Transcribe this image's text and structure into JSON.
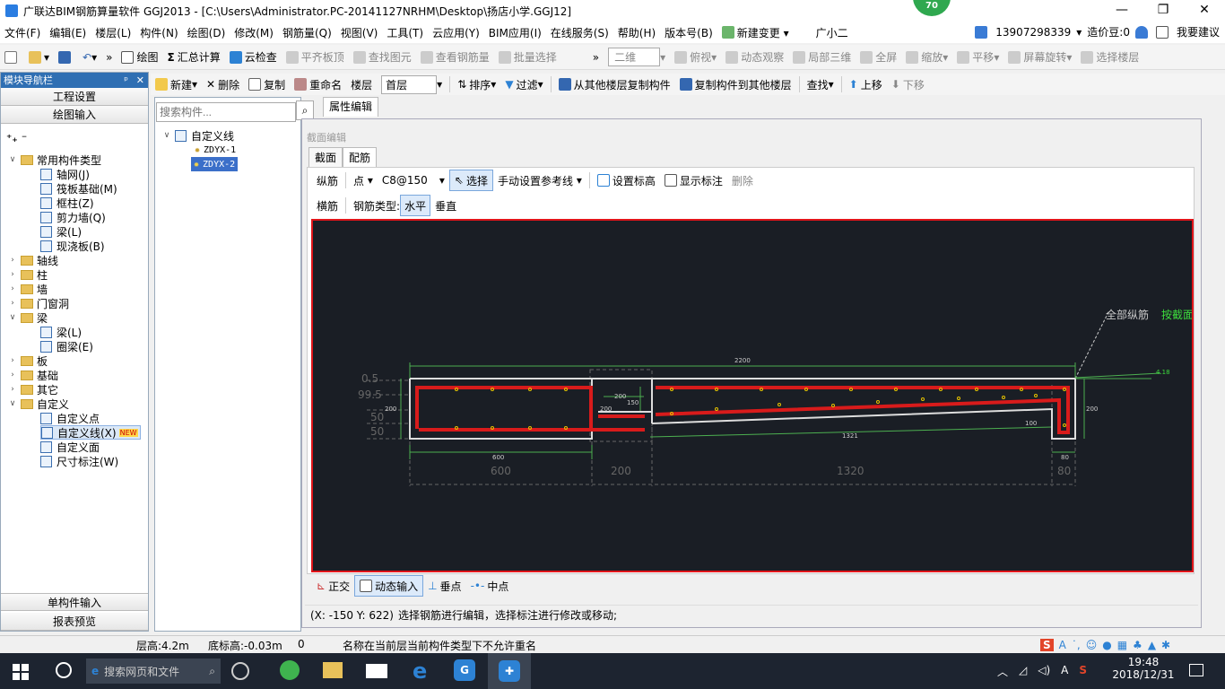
{
  "titlebar": {
    "title": "广联达BIM钢筋算量软件 GGJ2013 - [C:\\Users\\Administrator.PC-20141127NRHM\\Desktop\\扬店小学.GGJ12]",
    "badge": "70",
    "minimize": "—",
    "maximize": "❐",
    "close": "✕"
  },
  "menu": {
    "items": [
      "文件(F)",
      "编辑(E)",
      "楼层(L)",
      "构件(N)",
      "绘图(D)",
      "修改(M)",
      "钢筋量(Q)",
      "视图(V)",
      "工具(T)",
      "云应用(Y)",
      "BIM应用(I)",
      "在线服务(S)",
      "帮助(H)",
      "版本号(B)",
      "新建变更",
      "广小二"
    ],
    "phone": "13907298339",
    "price": "造价豆:0",
    "suggest": "我要建议"
  },
  "toolbar": {
    "draw": "绘图",
    "sum": "汇总计算",
    "cloud_check": "云检查",
    "align_top": "平齐板顶",
    "find": "查找图元",
    "view_rebar": "查看钢筋量",
    "batch": "批量选择",
    "view_mode": "二维",
    "top_view": "俯视",
    "dynamic": "动态观察",
    "local3d": "局部三维",
    "fullscreen": "全屏",
    "zoom": "缩放",
    "pan": "平移",
    "rotate": "屏幕旋转",
    "select_floor": "选择楼层"
  },
  "nav": {
    "header": "模块导航栏",
    "pin": "ᵖ",
    "close": "✕",
    "project_settings": "工程设置",
    "draw_input": "绘图输入",
    "items": [
      {
        "label": "常用构件类型"
      },
      {
        "label": "轴网(J)"
      },
      {
        "label": "筏板基础(M)"
      },
      {
        "label": "框柱(Z)"
      },
      {
        "label": "剪力墙(Q)"
      },
      {
        "label": "梁(L)"
      },
      {
        "label": "现浇板(B)"
      },
      {
        "label": "轴线"
      },
      {
        "label": "柱"
      },
      {
        "label": "墙"
      },
      {
        "label": "门窗洞"
      },
      {
        "label": "梁"
      },
      {
        "label": "梁(L)"
      },
      {
        "label": "圈梁(E)"
      },
      {
        "label": "板"
      },
      {
        "label": "基础"
      },
      {
        "label": "其它"
      },
      {
        "label": "自定义"
      },
      {
        "label": "自定义点"
      },
      {
        "label": "自定义线(X)"
      },
      {
        "label": "自定义面"
      },
      {
        "label": "尺寸标注(W)"
      }
    ],
    "new_tag": "NEW",
    "single_input": "单构件输入",
    "report": "报表预览"
  },
  "components": {
    "new": "新建",
    "delete": "删除",
    "copy": "复制",
    "rename": "重命名",
    "floor_label": "楼层",
    "floor_value": "首层",
    "sort": "排序",
    "filter": "过滤",
    "copy_from": "从其他楼层复制构件",
    "copy_to": "复制构件到其他楼层",
    "find": "查找",
    "up": "上移",
    "down": "下移",
    "search_placeholder": "搜索构件...",
    "root": "自定义线",
    "list": [
      "ZDYX-1",
      "ZDYX-2"
    ]
  },
  "editor": {
    "prop_tab": "属性编辑",
    "section_title": "截面编辑",
    "tabs": [
      "截面",
      "配筋"
    ],
    "longitudinal": "纵筋",
    "point": "点",
    "spacing": "C8@150",
    "select": "选择",
    "manual_ref": "手动设置参考线",
    "set_elev": "设置标高",
    "show_dim": "显示标注",
    "delete": "删除",
    "transverse": "横筋",
    "rebar_type": "钢筋类型:",
    "horizontal": "水平",
    "vertical": "垂直",
    "ortho": "正交",
    "dyn_input": "动态输入",
    "perp": "垂点",
    "mid": "中点",
    "coords": "(X: -150 Y: 622)",
    "hint": "选择钢筋进行编辑，选择标注进行修改或移动;"
  },
  "drawing": {
    "all_rebar": "全部纵筋",
    "by_section": "按截面",
    "dim_total": "2200",
    "dim_600": "600",
    "dim_200": "200",
    "dim_1320": "1320",
    "dim_80": "80",
    "dim_1321": "1321",
    "left_vals": [
      "0.5",
      "99.5",
      "50",
      "50"
    ],
    "h200": "200",
    "h200r": "200",
    "d200": "200",
    "d150": "150",
    "d100": "100",
    "lvl": "4.18"
  },
  "status": {
    "floor_height": "层高:4.2m",
    "base_elev": "底标高:-0.03m",
    "zero": "0",
    "msg": "名称在当前层当前构件类型下不允许重名"
  },
  "taskbar": {
    "search": "搜索网页和文件",
    "time": "19:48",
    "date": "2018/12/31",
    "ime": "A"
  }
}
